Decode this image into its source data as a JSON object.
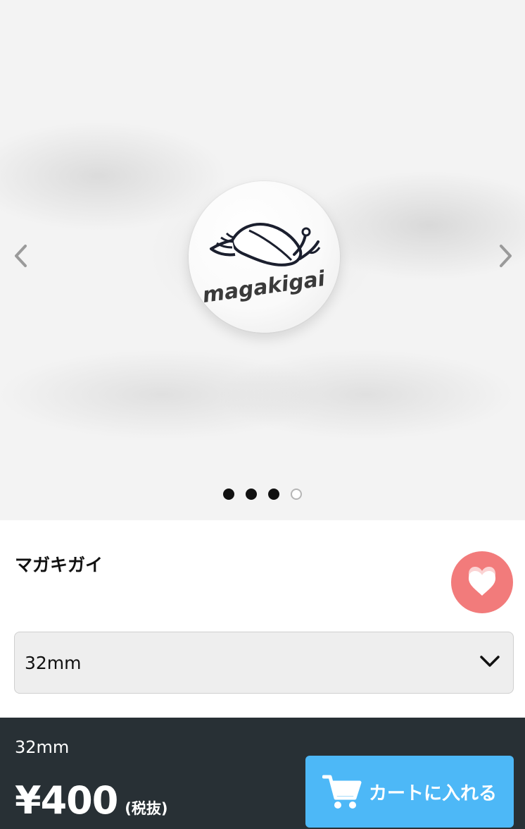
{
  "gallery": {
    "badge_text": "magakigai",
    "dots": [
      {
        "state": "filled"
      },
      {
        "state": "filled"
      },
      {
        "state": "filled"
      },
      {
        "state": "active-hollow"
      }
    ],
    "prev_icon": "chevron-left-icon",
    "next_icon": "chevron-right-icon"
  },
  "product": {
    "title": "マガキガイ",
    "favorite_icon": "heart-icon",
    "favorite_color": "#f27b7b"
  },
  "size_select": {
    "value": "32mm",
    "icon": "chevron-down-icon"
  },
  "purchase_bar": {
    "variant": "32mm",
    "price": "¥400",
    "tax_note": "(税抜)",
    "cart_button_label": "カートに入れる",
    "cart_icon": "cart-icon",
    "cart_button_color": "#4db8f7",
    "bar_color": "#283035"
  }
}
